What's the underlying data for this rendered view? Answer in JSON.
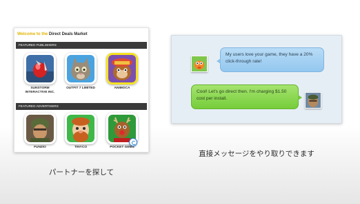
{
  "market": {
    "title_highlight": "Welcome to the ",
    "title_rest": "Direct Deals Market",
    "featured_publishers_label": "FEATURED PUBLISHERS",
    "featured_advertisers_label": "FEATURED ADVERTISERS",
    "publishers": [
      {
        "name": "SUNSTORM INTERACTIVE INC.",
        "icon": "sunstorm-game-icon",
        "highlighted": false
      },
      {
        "name": "OUTFIT 7 LIMITED",
        "icon": "talking-tom-icon",
        "highlighted": false
      },
      {
        "name": "ANIMOCA",
        "icon": "animoca-monkey-icon",
        "highlighted": true
      }
    ],
    "advertisers": [
      {
        "name": "FUNZIO",
        "icon": "soldier-game-icon"
      },
      {
        "name": "TINYCO",
        "icon": "tinyco-character-icon"
      },
      {
        "name": "POCKET GEMS",
        "icon": "reindeer-icon"
      }
    ]
  },
  "chat": {
    "messages": [
      {
        "from": "publisher",
        "text": "My users love your game, they have a 20% click-through rate!",
        "bubble_color": "#a8d4f4"
      },
      {
        "from": "advertiser",
        "text": "Cool! Let's go direct then. I'm charging $1.50 cost per install.",
        "bubble_color": "#8fd753"
      }
    ]
  },
  "captions": {
    "left": "パートナーを探して",
    "right": "直接メッセージをやり取りできます"
  },
  "colors": {
    "title_accent": "#e2b400",
    "section_bar": "#3a3a3a",
    "highlight_border": "#f5e21e",
    "chat_background": "#e6eef5"
  }
}
